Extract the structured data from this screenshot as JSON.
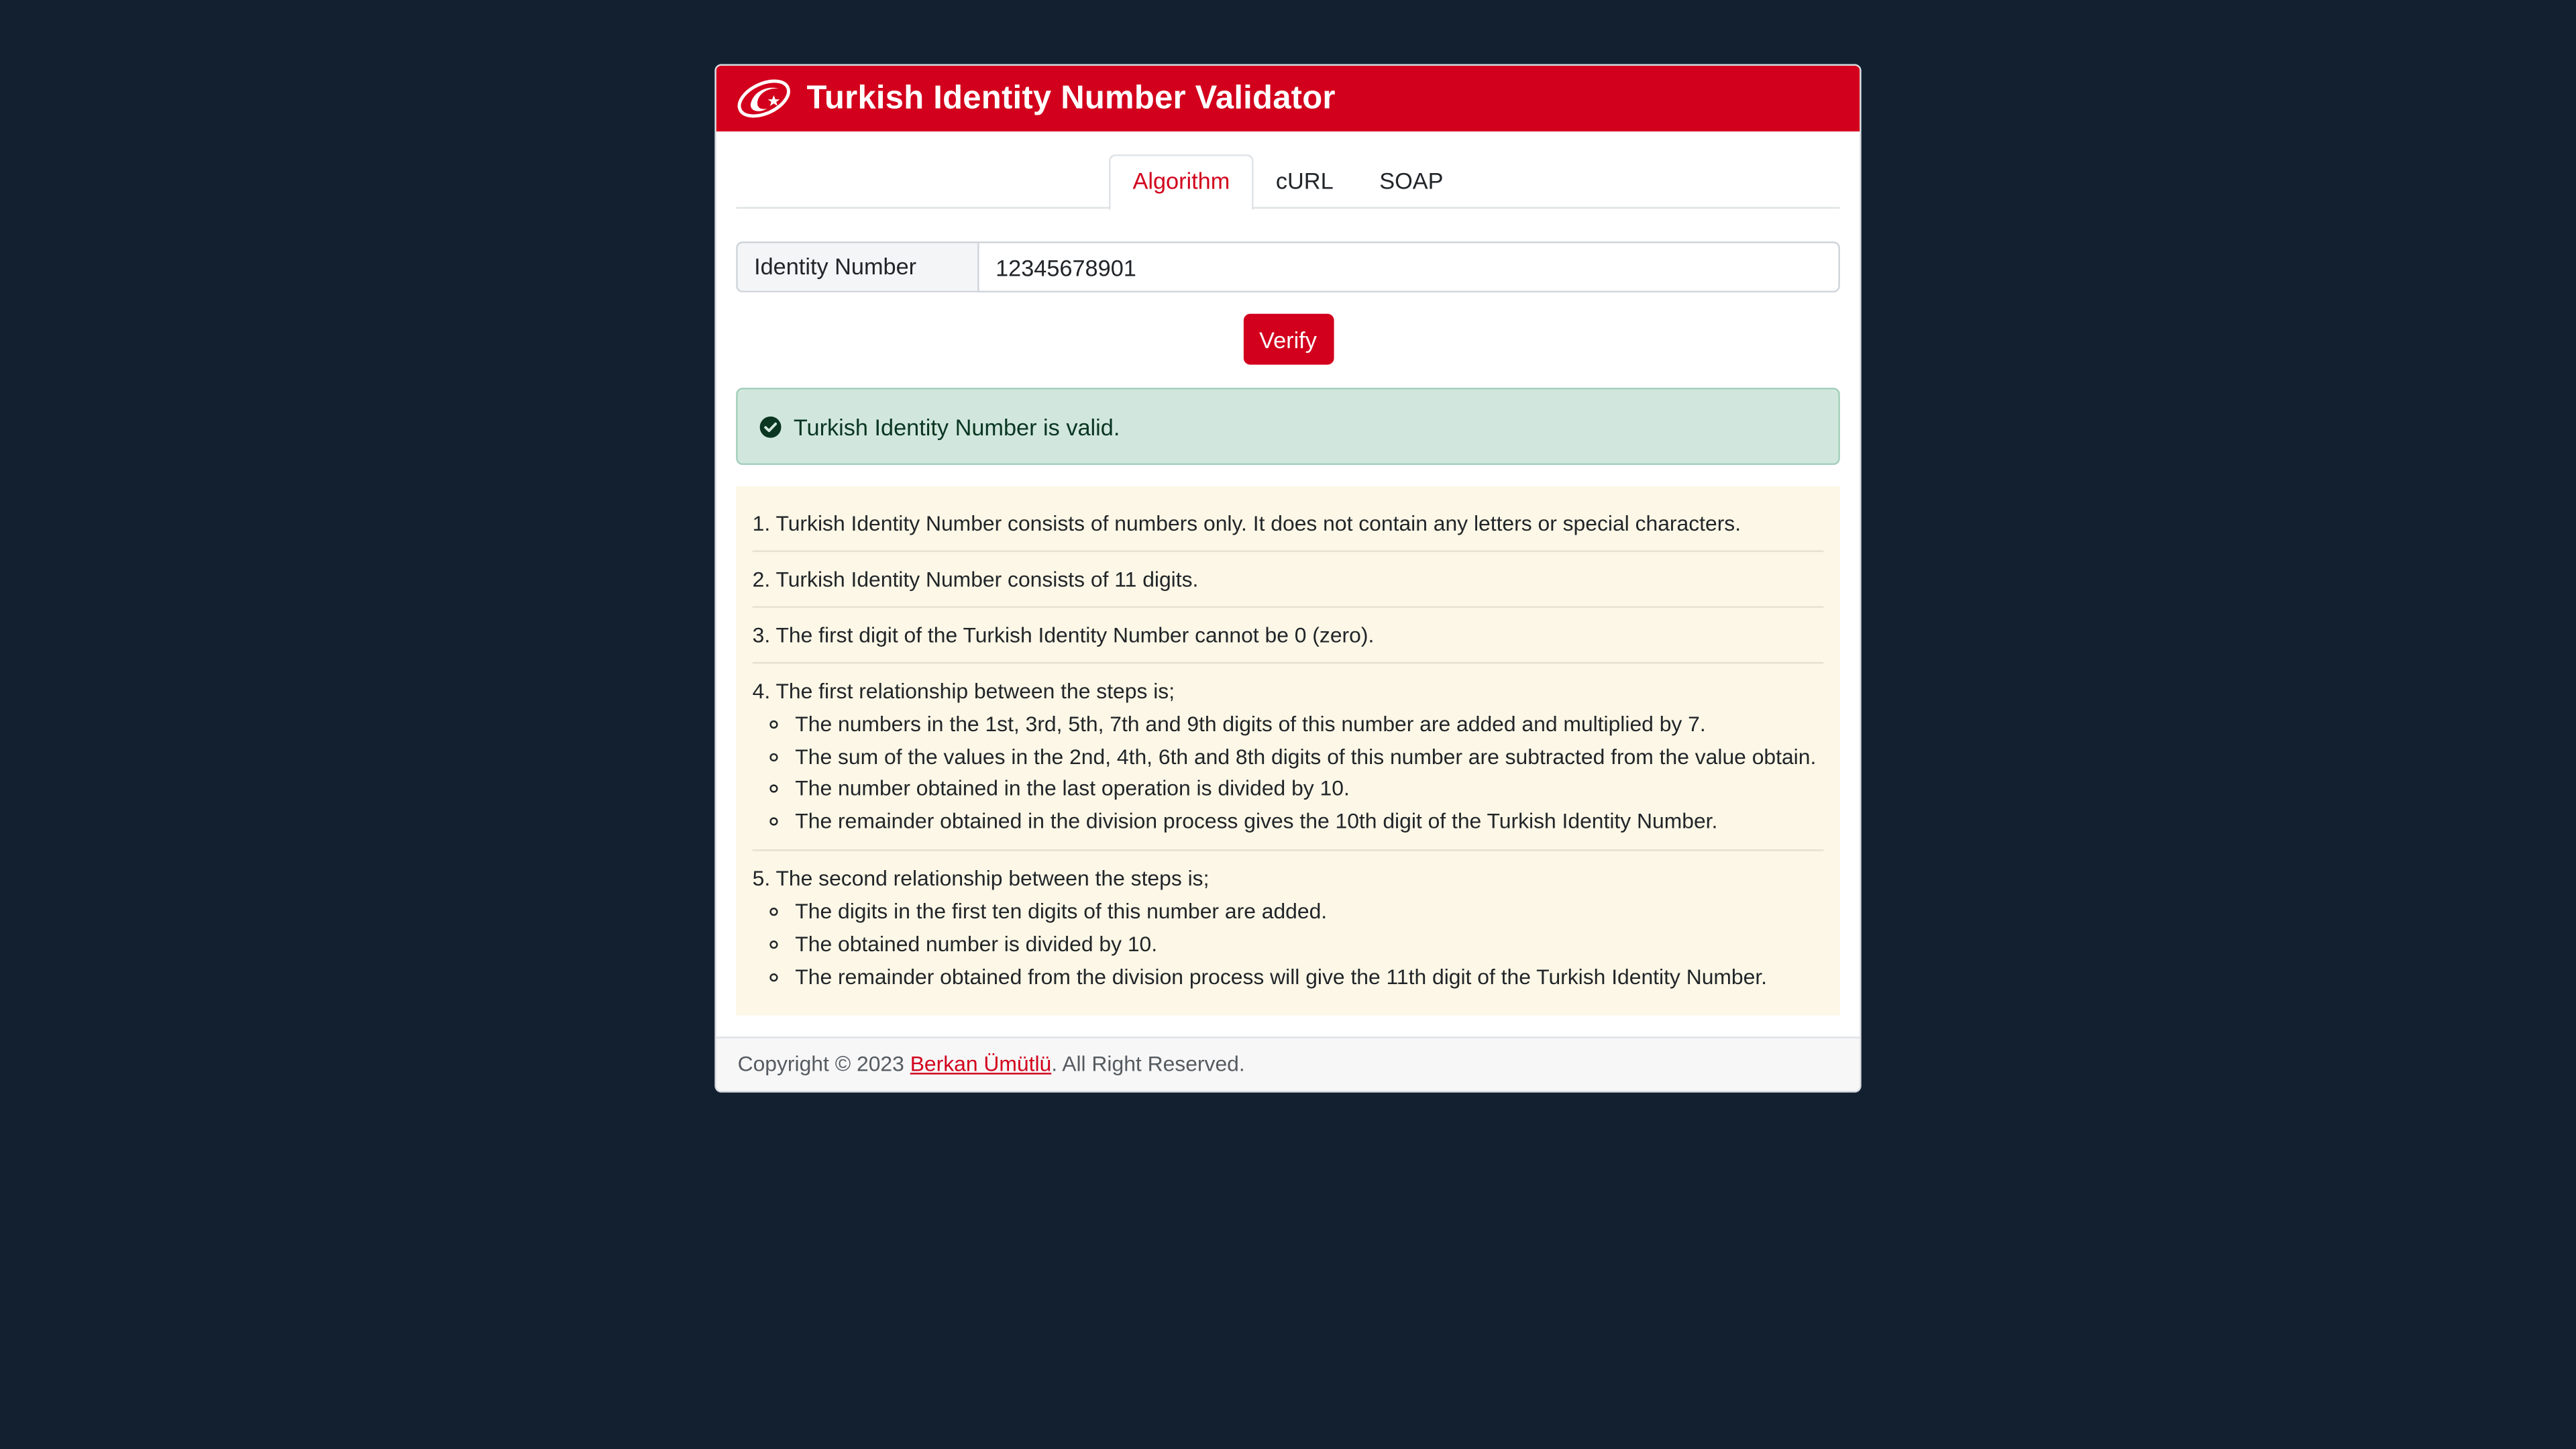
{
  "header": {
    "title": "Turkish Identity Number Validator",
    "logo_icon": "crescent-star-logo-icon",
    "brand_color": "#d2001c"
  },
  "tabs": [
    {
      "label": "Algorithm",
      "active": true
    },
    {
      "label": "cURL",
      "active": false
    },
    {
      "label": "SOAP",
      "active": false
    }
  ],
  "form": {
    "label": "Identity Number",
    "value": "12345678901",
    "verify_label": "Verify"
  },
  "alert": {
    "icon": "check-circle-icon",
    "text": "Turkish Identity Number is valid.",
    "color": "#d1e7dd"
  },
  "rules": {
    "r1": "1. Turkish Identity Number consists of numbers only. It does not contain any letters or special characters.",
    "r2": "2. Turkish Identity Number consists of 11 digits.",
    "r3": "3. The first digit of the Turkish Identity Number cannot be 0 (zero).",
    "r4": {
      "title": "4. The first relationship between the steps is;",
      "items": [
        "The numbers in the 1st, 3rd, 5th, 7th and 9th digits of this number are added and multiplied by 7.",
        "The sum of the values in the 2nd, 4th, 6th and 8th digits of this number are subtracted from the value obtain.",
        "The number obtained in the last operation is divided by 10.",
        "The remainder obtained in the division process gives the 10th digit of the Turkish Identity Number."
      ]
    },
    "r5": {
      "title": "5. The second relationship between the steps is;",
      "items": [
        "The digits in the first ten digits of this number are added.",
        "The obtained number is divided by 10.",
        "The remainder obtained from the division process will give the 11th digit of the Turkish Identity Number."
      ]
    }
  },
  "footer": {
    "prefix": "Copyright © 2023 ",
    "author": "Berkan Ümütlü",
    "suffix": ". All Right Reserved."
  }
}
